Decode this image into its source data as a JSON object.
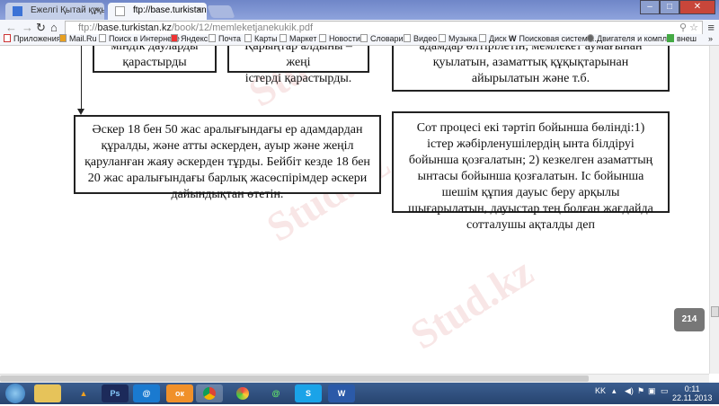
{
  "browser": {
    "tabs": [
      {
        "label": "Ежелгі Қытай құқығы - П",
        "active": false
      },
      {
        "label": "ftp://base.turkistan.kz/boo",
        "active": true
      }
    ],
    "url_prefix": "ftp://",
    "url_host": "base.turkistan.kz",
    "url_path": "/book/12/memleketjanekukik.pdf",
    "bookmarks": [
      "Приложения",
      "Mail.Ru",
      "Поиск в Интернете",
      "Яндекс",
      "Почта",
      "Карты",
      "Маркет",
      "Новости",
      "Словари",
      "Видео",
      "Музыка",
      "Диск",
      "Поисковая система...",
      "Двигателя и компл...",
      "внеш"
    ],
    "more": "»"
  },
  "document": {
    "box1_lines": [
      "міндік дауларды",
      "қарастырды"
    ],
    "box2_lines": [
      "Қарыңтар алдыны – жеңі",
      "істерді қарастырды."
    ],
    "box3_lines": [
      "адамдар өлтірілетін, мемлекет аумағынан",
      "қуылатын, азаматтық құқықтарынан",
      "айырылатын және т.б."
    ],
    "box4_text": "Әскер 18 бен 50 жас аралығындағы ер адамдардан құралды, және атты әскерден, ауыр және жеңіл қаруланған жаяу әскерден тұрды. Бейбіт кезде 18 бен 20 жас аралығындағы барлық жасөспірімдер әскери дайындықтан өтетін.",
    "box5_text": "Сот процесі екі тәртіп бойынша бөлінді:1) істер жәбірленушілердің ынта білдіруі бойынша қозғалатын; 2) кезкелген азаматтың ынтасы бойынша қозғалатын. Іс бойынша шешім құпия дауыс беру арқылы шығарылатын, дауыстар тең болған жағдайда сотталушы ақталды деп",
    "page_number": "214",
    "watermark_text": "Stud.kz"
  },
  "taskbar": {
    "apps": [
      "explorer",
      "aimp",
      "photoshop",
      "mail-agent",
      "odnoklassniki",
      "chrome",
      "games",
      "mail-ru-agent",
      "skype",
      "word"
    ],
    "app_labels": {
      "photoshop": "Ps",
      "word": "W"
    },
    "language": "KK",
    "time": "0:11",
    "date": "22.11.2013"
  }
}
